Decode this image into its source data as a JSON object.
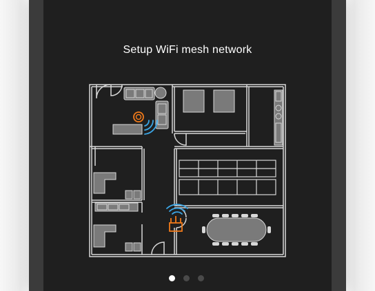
{
  "onboarding": {
    "title": "Setup WiFi mesh network",
    "pagination": {
      "total": 3,
      "active_index": 0
    }
  },
  "colors": {
    "screen_background": "#1f1f1f",
    "device_bezel": "#3b3b3b",
    "plan_lines": "#d8d8d8",
    "furniture_fill": "#7a7a7a",
    "wifi_signal": "#3ba6e6",
    "router_accent": "#f07a1a",
    "dot_active": "#ffffff",
    "dot_inactive": "#4a4a4a"
  },
  "icons": {
    "router_primary": "router-icon",
    "wifi_wave": "wifi-signal-icon",
    "mesh_node": "mesh-node-icon"
  }
}
